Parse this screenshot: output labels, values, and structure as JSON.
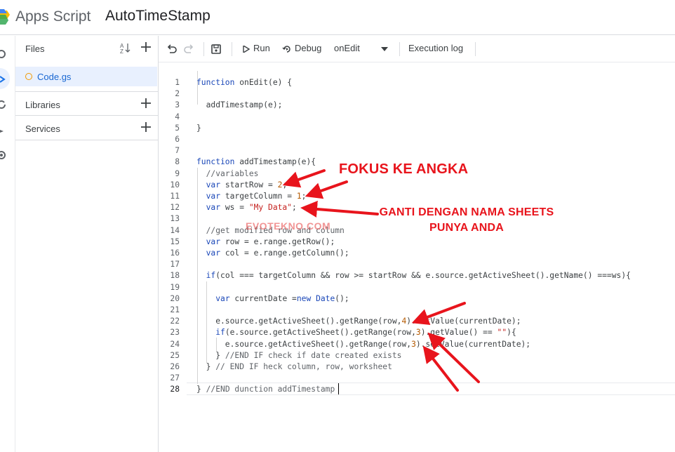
{
  "header": {
    "app_name": "Apps Script",
    "project_title": "AutoTimeStamp"
  },
  "panel": {
    "files_label": "Files",
    "sort_icon_text": "AZ",
    "file_name": "Code.gs",
    "libraries_label": "Libraries",
    "services_label": "Services"
  },
  "toolbar": {
    "run_label": "Run",
    "debug_label": "Debug",
    "function_select": "onEdit",
    "execution_log_label": "Execution log"
  },
  "editor": {
    "current_line": 28,
    "lines": [
      {
        "n": "1",
        "text": "function onEdit(e) {"
      },
      {
        "n": "2",
        "text": ""
      },
      {
        "n": "3",
        "text": "  addTimestamp(e);"
      },
      {
        "n": "4",
        "text": ""
      },
      {
        "n": "5",
        "text": "}"
      },
      {
        "n": "6",
        "text": ""
      },
      {
        "n": "7",
        "text": ""
      },
      {
        "n": "8",
        "text": "function addTimestamp(e){"
      },
      {
        "n": "9",
        "text": "  //variables"
      },
      {
        "n": "10",
        "text": "  var startRow = 2;"
      },
      {
        "n": "11",
        "text": "  var targetColumn = 1;"
      },
      {
        "n": "12",
        "text": "  var ws = \"My Data\";"
      },
      {
        "n": "13",
        "text": ""
      },
      {
        "n": "14",
        "text": "  //get modified row and column"
      },
      {
        "n": "15",
        "text": "  var row = e.range.getRow();"
      },
      {
        "n": "16",
        "text": "  var col = e.range.getColumn();"
      },
      {
        "n": "17",
        "text": ""
      },
      {
        "n": "18",
        "text": "  if(col === targetColumn && row >= startRow && e.source.getActiveSheet().getName() ===ws){"
      },
      {
        "n": "19",
        "text": ""
      },
      {
        "n": "20",
        "text": "    var currentDate =new Date();"
      },
      {
        "n": "21",
        "text": ""
      },
      {
        "n": "22",
        "text": "    e.source.getActiveSheet().getRange(row,4).setValue(currentDate);"
      },
      {
        "n": "23",
        "text": "    if(e.source.getActiveSheet().getRange(row,3).getValue() == \"\"){"
      },
      {
        "n": "24",
        "text": "      e.source.getActiveSheet().getRange(row,3).setValue(currentDate);"
      },
      {
        "n": "25",
        "text": "    } //END IF check if date created exists"
      },
      {
        "n": "26",
        "text": "  } // END IF heck column, row, worksheet"
      },
      {
        "n": "27",
        "text": ""
      },
      {
        "n": "28",
        "text": "} //END dunction addTimestamp"
      }
    ]
  },
  "annotations": {
    "focus_number": "FOKUS KE ANGKA",
    "rename_sheet_line1": "GANTI DENGAN NAMA SHEETS",
    "rename_sheet_line2": "PUNYA ANDA",
    "watermark": "EVOTEKNO.COM",
    "color": "#e8141c"
  },
  "colors": {
    "accent": "#1a73e8",
    "keyword": "#1a47b8",
    "string": "#c5221f",
    "number": "#b45900",
    "file_dot": "#f29900"
  }
}
